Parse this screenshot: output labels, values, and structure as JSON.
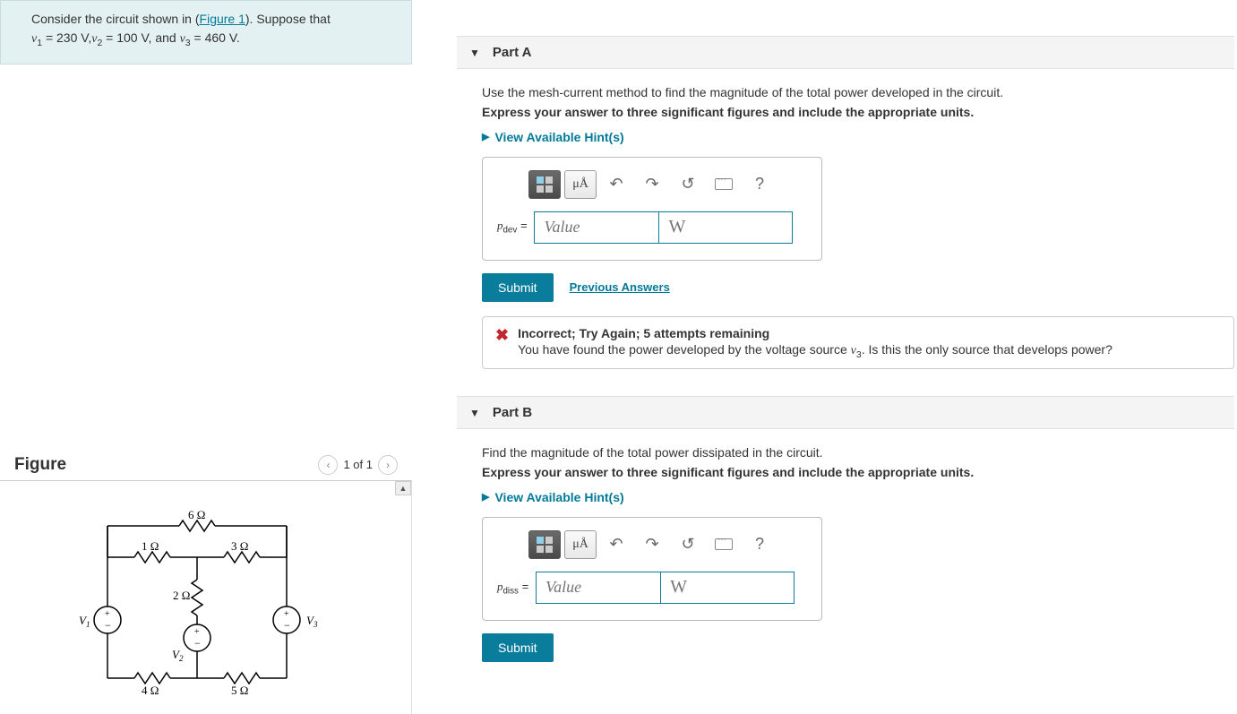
{
  "problem": {
    "intro_prefix": "Consider the circuit shown in (",
    "figure_link": "Figure 1",
    "intro_suffix": "). Suppose that",
    "v1_label": "v",
    "v1_sub": "1",
    "v1_eq": " = 230 ",
    "v2_label": "v",
    "v2_sub": "2",
    "v2_eq": " = 100 ",
    "v3_label": "v",
    "v3_sub": "3",
    "v3_eq": " = 460 ",
    "volt": "V",
    "comma": ",",
    "and": ", and ",
    "period": "."
  },
  "figure": {
    "title": "Figure",
    "nav_text": "1 of 1",
    "r_top": "6 Ω",
    "r_left": "1 Ω",
    "r_right": "3 Ω",
    "r_mid": "2 Ω",
    "r_bl": "4 Ω",
    "r_br": "5 Ω",
    "v1": "V",
    "v1s": "1",
    "v2": "V",
    "v2s": "2",
    "v3": "V",
    "v3s": "3"
  },
  "partA": {
    "title": "Part A",
    "instr": "Use the mesh-current method to find the magnitude of the total power developed in the circuit.",
    "bold": "Express your answer to three significant figures and include the appropriate units.",
    "hint": "View Available Hint(s)",
    "var_html": "p",
    "var_sub": "dev",
    "eq": " = ",
    "value_ph": "Value",
    "unit_ph": "W",
    "submit": "Submit",
    "prev": "Previous Answers",
    "spec_char": "μÅ",
    "help": "?",
    "feedback_head": "Incorrect; Try Again; 5 attempts remaining",
    "feedback_body_pre": "You have found the power developed by the voltage source ",
    "feedback_v": "v",
    "feedback_vs": "3",
    "feedback_body_post": ". Is this the only source that develops power?"
  },
  "partB": {
    "title": "Part B",
    "instr": "Find the magnitude of the total power dissipated in the circuit.",
    "bold": "Express your answer to three significant figures and include the appropriate units.",
    "hint": "View Available Hint(s)",
    "var_html": "p",
    "var_sub": "diss",
    "eq": " = ",
    "value_ph": "Value",
    "unit_ph": "W",
    "submit": "Submit",
    "spec_char": "μÅ",
    "help": "?"
  }
}
